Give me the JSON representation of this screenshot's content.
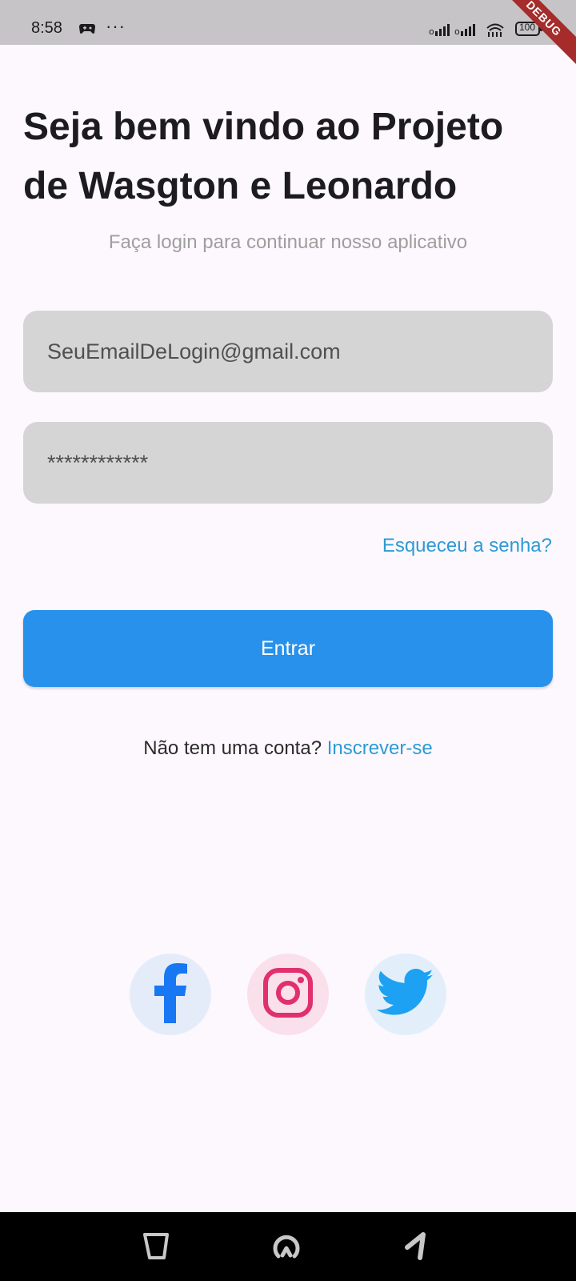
{
  "status_bar": {
    "time": "8:58",
    "more": "···",
    "battery": "100",
    "app_icon": "game-controller-icon",
    "signal_icon": "signal-icon",
    "wifi_icon": "wifi-icon",
    "battery_icon": "battery-icon"
  },
  "debug_banner": "DEBUG",
  "headline": "Seja bem vindo ao  Projeto de Wasgton e Leonardo",
  "subtitle": "Faça login para continuar nosso aplicativo",
  "email_field": {
    "value": "SeuEmailDeLogin@gmail.com"
  },
  "password_field": {
    "value": "************"
  },
  "forgot_password": "Esqueceu a senha?",
  "login_button": "Entrar",
  "signup": {
    "prompt": "Não tem uma conta? ",
    "link": "Inscrever-se"
  },
  "social": {
    "facebook_icon": "facebook-icon",
    "instagram_icon": "instagram-icon",
    "twitter_icon": "twitter-icon",
    "facebook_color": "#1877f2",
    "instagram_color": "#e1306c",
    "twitter_color": "#1da1f2"
  },
  "nav_bar": {
    "back_icon": "back-icon",
    "home_icon": "home-icon",
    "recent_icon": "recent-apps-icon"
  },
  "colors": {
    "background": "#fdf8fd",
    "primary_button": "#2891eb",
    "link": "#2d9ad5",
    "input_fill": "#d5d5d5",
    "debug_banner": "#a62b2b"
  }
}
